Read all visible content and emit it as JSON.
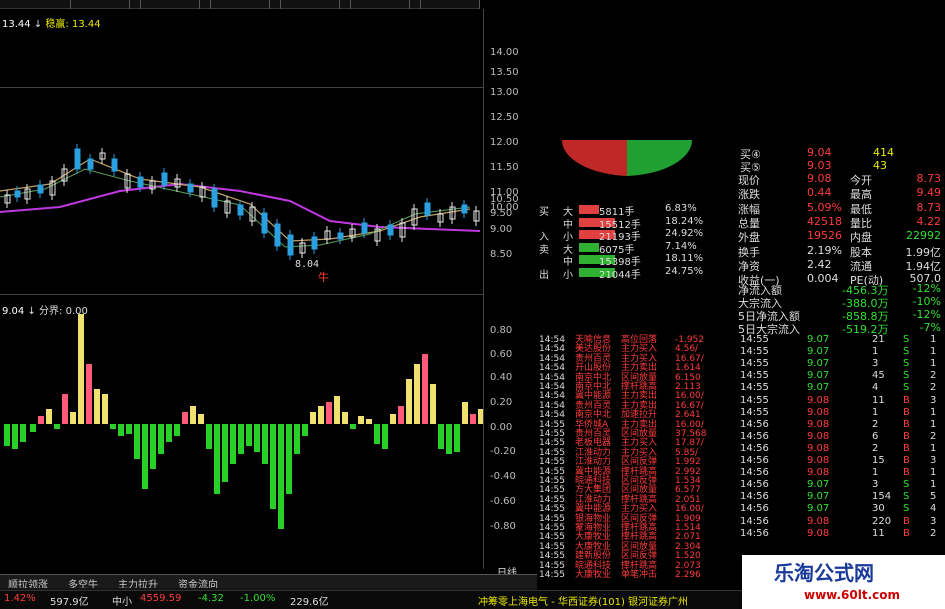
{
  "top_info": {
    "left": "13.44",
    "label": "稳赢: 13.44"
  },
  "lower_info": {
    "text": "9.04",
    "label": "分界: 0.00"
  },
  "price_axis": [
    "14.00",
    "13.50",
    "13.00",
    "12.50",
    "12.00",
    "11.50",
    "11.00",
    "10.50",
    "10.00",
    "9.50",
    "9.00",
    "8.50"
  ],
  "osc_axis": [
    "0.80",
    "0.60",
    "0.40",
    "0.20",
    "0.00",
    "-0.20",
    "-0.40",
    "-0.60",
    "-0.80"
  ],
  "chart_annotations": {
    "low": "8.04",
    "marker": "牛"
  },
  "period_label": "日线",
  "bottom_tabs": [
    "顺拉领涨",
    "多空牛",
    "主力拉升",
    "资金流向"
  ],
  "sub_tabs": [
    "评级",
    "个股评测",
    "资金分布",
    "行业新闻",
    "综合新闻",
    "买卖详盘",
    "成交明细",
    "分价表"
  ],
  "right_tabs": [
    "资讯工场",
    "主力",
    "风向",
    "分价",
    "筹码",
    "笔"
  ],
  "order_book": [
    {
      "label": "买④",
      "price": "9.04",
      "vol": "414"
    },
    {
      "label": "买⑤",
      "price": "9.03",
      "vol": "43"
    }
  ],
  "quote": [
    {
      "k1": "现价",
      "v1": "9.08",
      "k2": "今开",
      "v2": "8.73"
    },
    {
      "k1": "涨跌",
      "v1": "0.44",
      "k2": "最高",
      "v2": "9.49"
    },
    {
      "k1": "涨幅",
      "v1": "5.09%",
      "k2": "最低",
      "v2": "8.73"
    },
    {
      "k1": "总量",
      "v1": "42518",
      "k2": "量比",
      "v2": "4.22"
    },
    {
      "k1": "外盘",
      "v1": "19526",
      "k2": "内盘",
      "v2": "22992"
    },
    {
      "k1": "换手",
      "v1": "2.19%",
      "k2": "股本",
      "v2": "1.99亿"
    },
    {
      "k1": "净资",
      "v1": "2.42",
      "k2": "流通",
      "v2": "1.94亿"
    },
    {
      "k1": "收益(一)",
      "v1": "0.004",
      "k2": "PE(动)",
      "v2": "507.0"
    }
  ],
  "flows": [
    {
      "k": "净流入额",
      "v": "-456.3万",
      "p": "-12%"
    },
    {
      "k": "大宗流入",
      "v": "-388.0万",
      "p": "-10%"
    },
    {
      "k": "5日净流入额",
      "v": "-858.8万",
      "p": "-12%"
    },
    {
      "k": "5日大宗流入",
      "v": "-519.2万",
      "p": "-7%"
    }
  ],
  "fund_table": [
    {
      "side": "买",
      "size": "大",
      "vol": "5811手",
      "pct": "6.83%"
    },
    {
      "side": "",
      "size": "中",
      "vol": "15512手",
      "pct": "18.24%"
    },
    {
      "side": "入",
      "size": "小",
      "vol": "21193手",
      "pct": "24.92%"
    },
    {
      "side": "卖",
      "size": "大",
      "vol": "6075手",
      "pct": "7.14%"
    },
    {
      "side": "",
      "size": "中",
      "vol": "15398手",
      "pct": "18.11%"
    },
    {
      "side": "出",
      "size": "小",
      "vol": "21044手",
      "pct": "24.75%"
    }
  ],
  "news": [
    {
      "t": "14:54",
      "n": "天喻信息",
      "a": "高位回落",
      "v": "-1.952"
    },
    {
      "t": "14:54",
      "n": "美达股份",
      "a": "主力买入",
      "v": "4.56/"
    },
    {
      "t": "14:54",
      "n": "贵州百灵",
      "a": "主力买入",
      "v": "16.67/"
    },
    {
      "t": "14:54",
      "n": "开山股份",
      "a": "主力卖出",
      "v": "1.614"
    },
    {
      "t": "14:54",
      "n": "南京中北",
      "a": "区间放量",
      "v": "6.150"
    },
    {
      "t": "14:54",
      "n": "南京中北",
      "a": "撑杆跳高",
      "v": "2.113"
    },
    {
      "t": "14:54",
      "n": "冀中能源",
      "a": "主力卖出",
      "v": "16.00/"
    },
    {
      "t": "14:54",
      "n": "贵州百灵",
      "a": "主力卖出",
      "v": "16.67/"
    },
    {
      "t": "14:54",
      "n": "南京中北",
      "a": "加速拉升",
      "v": "2.641"
    },
    {
      "t": "14:55",
      "n": "华侨城A",
      "a": "主力卖出",
      "v": "16.00/"
    },
    {
      "t": "14:55",
      "n": "贵州百灵",
      "a": "区间放量",
      "v": "37.568"
    },
    {
      "t": "14:55",
      "n": "老板电器",
      "a": "主力买入",
      "v": "17.87/"
    },
    {
      "t": "14:55",
      "n": "江淮动力",
      "a": "主力买入",
      "v": "5.85/"
    },
    {
      "t": "14:55",
      "n": "江淮动力",
      "a": "区间反弹",
      "v": "1.992"
    },
    {
      "t": "14:55",
      "n": "冀中能源",
      "a": "撑杆跳高",
      "v": "2.992"
    },
    {
      "t": "14:55",
      "n": "皖通科技",
      "a": "区间反弹",
      "v": "1.534"
    },
    {
      "t": "14:55",
      "n": "方大集团",
      "a": "区间放量",
      "v": "6.577"
    },
    {
      "t": "14:55",
      "n": "江淮动力",
      "a": "撑杆跳高",
      "v": "2.051"
    },
    {
      "t": "14:55",
      "n": "冀中能源",
      "a": "主力买入",
      "v": "16.00/"
    },
    {
      "t": "14:55",
      "n": "银海物业",
      "a": "区间反弹",
      "v": "1.909"
    },
    {
      "t": "14:55",
      "n": "蒙海物业",
      "a": "撑杆跳高",
      "v": "1.514"
    },
    {
      "t": "14:55",
      "n": "大康牧业",
      "a": "撑杆跳高",
      "v": "2.071"
    },
    {
      "t": "14:55",
      "n": "大康牧业",
      "a": "区间放量",
      "v": "2.304"
    },
    {
      "t": "14:55",
      "n": "建新股份",
      "a": "区间反弹",
      "v": "1.520"
    },
    {
      "t": "14:55",
      "n": "皖通科技",
      "a": "撑杆跳高",
      "v": "2.073"
    },
    {
      "t": "14:55",
      "n": "大康牧业",
      "a": "单笔冲击",
      "v": "2.296"
    }
  ],
  "ticks": [
    {
      "t": "14:55",
      "p": "9.07",
      "v": "21",
      "d": "S",
      "c": "1"
    },
    {
      "t": "14:55",
      "p": "9.07",
      "v": "1",
      "d": "S",
      "c": "1"
    },
    {
      "t": "14:55",
      "p": "9.07",
      "v": "3",
      "d": "S",
      "c": "1"
    },
    {
      "t": "14:55",
      "p": "9.07",
      "v": "45",
      "d": "S",
      "c": "2"
    },
    {
      "t": "14:55",
      "p": "9.07",
      "v": "4",
      "d": "S",
      "c": "2"
    },
    {
      "t": "14:55",
      "p": "9.08",
      "v": "11",
      "d": "B",
      "c": "3"
    },
    {
      "t": "14:55",
      "p": "9.08",
      "v": "1",
      "d": "B",
      "c": "1"
    },
    {
      "t": "14:56",
      "p": "9.08",
      "v": "2",
      "d": "B",
      "c": "1"
    },
    {
      "t": "14:56",
      "p": "9.08",
      "v": "6",
      "d": "B",
      "c": "2"
    },
    {
      "t": "14:56",
      "p": "9.08",
      "v": "2",
      "d": "B",
      "c": "1"
    },
    {
      "t": "14:56",
      "p": "9.08",
      "v": "15",
      "d": "B",
      "c": "3"
    },
    {
      "t": "14:56",
      "p": "9.08",
      "v": "1",
      "d": "B",
      "c": "1"
    },
    {
      "t": "14:56",
      "p": "9.07",
      "v": "3",
      "d": "S",
      "c": "1"
    },
    {
      "t": "14:56",
      "p": "9.07",
      "v": "154",
      "d": "S",
      "c": "5"
    },
    {
      "t": "14:56",
      "p": "9.07",
      "v": "30",
      "d": "S",
      "c": "4"
    },
    {
      "t": "14:56",
      "p": "9.08",
      "v": "220",
      "d": "B",
      "c": "3"
    },
    {
      "t": "14:56",
      "p": "9.08",
      "v": "11",
      "d": "B",
      "c": "2"
    }
  ],
  "status": {
    "a": "1.42%",
    "b": "597.9亿",
    "c": "中小",
    "d": "4559.59",
    "e": "-4.32",
    "f": "-1.00%",
    "g": "229.6亿",
    "h": "冲筹零上海电气 - 华西证券(101) 银河证券广州"
  },
  "watermark": {
    "title": "乐淘公式网",
    "url": "www.60lt.com"
  },
  "colors": {
    "up": "#ff3c3c",
    "down": "#33e033",
    "accent": "#e8e800"
  }
}
